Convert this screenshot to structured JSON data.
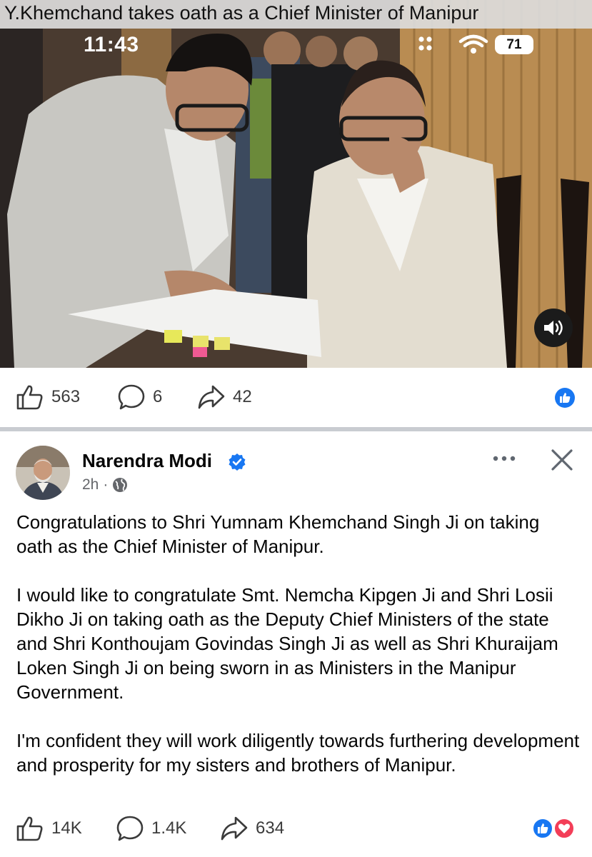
{
  "video": {
    "caption": "Y.Khemchand takes oath as a Chief Minister of Manipur",
    "status_time": "11:43",
    "battery": "71"
  },
  "video_actions": {
    "likes": "563",
    "comments": "6",
    "shares": "42"
  },
  "post": {
    "author": "Narendra Modi",
    "time": "2h",
    "separator": "·",
    "paragraphs": [
      "Congratulations to Shri Yumnam Khemchand Singh Ji on taking oath as the Chief Minister of Manipur.",
      "I would like to congratulate Smt. Nemcha Kipgen Ji and Shri Losii Dikho Ji on taking oath as the Deputy Chief Ministers of the state and Shri Konthoujam Govindas Singh Ji as well as Shri Khuraijam Loken Singh Ji on being sworn in as Ministers in the Manipur Government.",
      "I'm confident they will work diligently towards furthering development and prosperity for my sisters and brothers of Manipur."
    ]
  },
  "post_actions": {
    "likes": "14K",
    "comments": "1.4K",
    "shares": "634"
  },
  "colors": {
    "like_blue": "#1877f2",
    "love_red": "#f33e58",
    "verified_blue": "#1877f2",
    "meta_gray": "#65676b"
  },
  "icons": [
    "like-icon",
    "comment-icon",
    "share-icon",
    "verified-badge-icon",
    "globe-icon",
    "more-options-icon",
    "close-icon",
    "sound-icon",
    "wifi-icon",
    "reaction-like-icon",
    "reaction-love-icon"
  ]
}
